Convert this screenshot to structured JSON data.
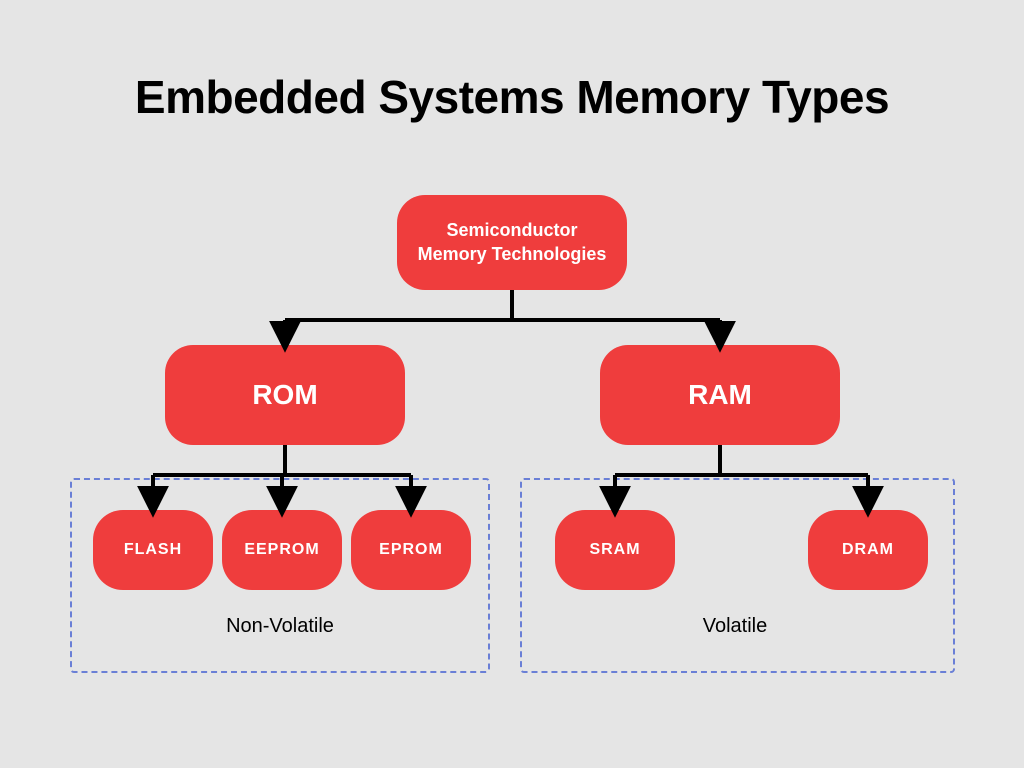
{
  "title": "Embedded Systems Memory Types",
  "root": {
    "label": "Semiconductor\nMemory Technologies"
  },
  "categories": {
    "rom": {
      "label": "ROM"
    },
    "ram": {
      "label": "RAM"
    }
  },
  "leaves": {
    "flash": {
      "label": "FLASH"
    },
    "eeprom": {
      "label": "EEPROM"
    },
    "eprom": {
      "label": "EPROM"
    },
    "sram": {
      "label": "SRAM"
    },
    "dram": {
      "label": "DRAM"
    }
  },
  "groups": {
    "nonvolatile": {
      "label": "Non-Volatile"
    },
    "volatile": {
      "label": "Volatile"
    }
  },
  "colors": {
    "node_bg": "#ef3d3d",
    "node_text": "#ffffff",
    "page_bg": "#e5e5e5",
    "group_border": "#6a7fd6",
    "connector": "#000000"
  }
}
